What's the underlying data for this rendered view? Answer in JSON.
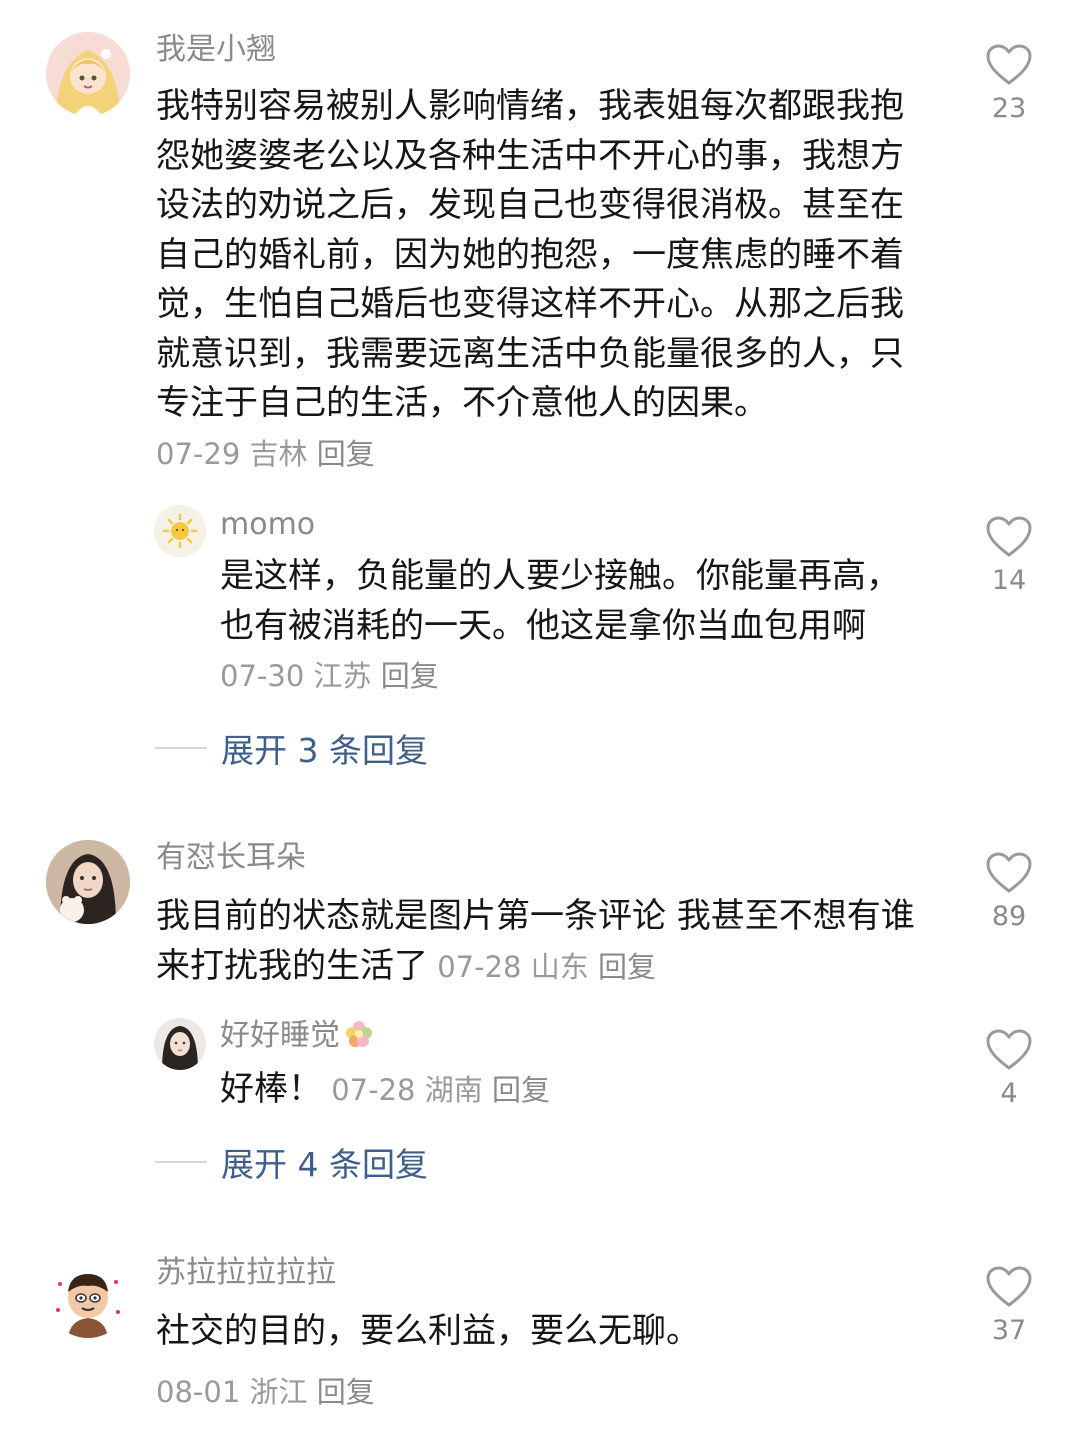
{
  "comments": [
    {
      "username": "我是小翘",
      "text": "我特别容易被别人影响情绪，我表姐每次都跟我抱怨她婆婆老公以及各种生活中不开心的事，我想方设法的劝说之后，发现自己也变得很消极。甚至在自己的婚礼前，因为她的抱怨，一度焦虑的睡不着觉，生怕自己婚后也变得这样不开心。从那之后我就意识到，我需要远离生活中负能量很多的人，只专注于自己的生活，不介意他人的因果。",
      "date": "07-29",
      "location": "吉林",
      "reply_label": "回复",
      "likes": "23",
      "avatar_icon": "cartoon-girl-avatar",
      "replies": [
        {
          "username": "momo",
          "text": "是这样，负能量的人要少接触。你能量再高，也有被消耗的一天。他这是拿你当血包用啊",
          "date": "07-30",
          "location": "江苏",
          "reply_label": "回复",
          "likes": "14",
          "avatar_icon": "sun-avatar"
        }
      ],
      "expand_label": "展开 3 条回复"
    },
    {
      "username": "有怼长耳朵",
      "text": "我目前的状态就是图片第一条评论 我甚至不想有谁来打扰我的生活了",
      "date": "07-28",
      "location": "山东",
      "reply_label": "回复",
      "likes": "89",
      "avatar_icon": "photo-avatar",
      "replies": [
        {
          "username": "好好睡觉",
          "text": "好棒！",
          "date": "07-28",
          "location": "湖南",
          "reply_label": "回复",
          "likes": "4",
          "avatar_icon": "portrait-avatar",
          "name_emoji": "flower-emoji"
        }
      ],
      "expand_label": "展开 4 条回复"
    },
    {
      "username": "苏拉拉拉拉拉",
      "text": "社交的目的，要么利益，要么无聊。",
      "date": "08-01",
      "location": "浙江",
      "reply_label": "回复",
      "likes": "37",
      "avatar_icon": "cartoon-boy-avatar"
    }
  ],
  "colors": {
    "username": "#8a8a8a",
    "body": "#161616",
    "meta": "#9a9a9a",
    "expand_link": "#3f5f8a",
    "heart_outline": "#9a9a9a"
  }
}
